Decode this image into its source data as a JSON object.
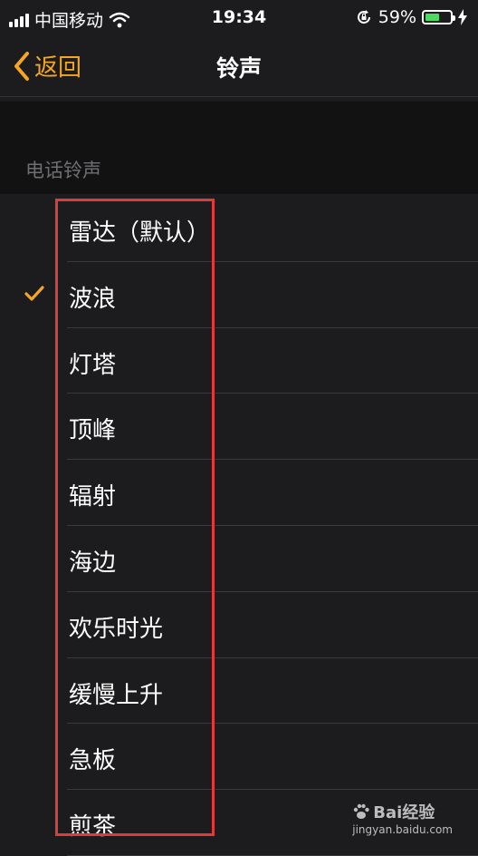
{
  "status_bar": {
    "carrier": "中国移动",
    "time": "19:34",
    "battery_percent": "59%",
    "battery_level": 0.59,
    "battery_color": "#4cd964",
    "icons": [
      "signal-bars-icon",
      "wifi-icon",
      "rotation-lock-icon",
      "battery-icon",
      "charging-bolt-icon"
    ]
  },
  "nav": {
    "back_label": "返回",
    "title": "铃声",
    "accent_color": "#f5a623"
  },
  "section": {
    "header": "电话铃声"
  },
  "ringtones": [
    {
      "label": "雷达（默认）",
      "selected": false
    },
    {
      "label": "波浪",
      "selected": true
    },
    {
      "label": "灯塔",
      "selected": false
    },
    {
      "label": "顶峰",
      "selected": false
    },
    {
      "label": "辐射",
      "selected": false
    },
    {
      "label": "海边",
      "selected": false
    },
    {
      "label": "欢乐时光",
      "selected": false
    },
    {
      "label": "缓慢上升",
      "selected": false
    },
    {
      "label": "急板",
      "selected": false
    },
    {
      "label": "煎茶",
      "selected": false
    }
  ],
  "watermark": {
    "brand": "Bai经验",
    "url": "jingyan.baidu.com"
  },
  "annotation_color": "#e03a3a"
}
